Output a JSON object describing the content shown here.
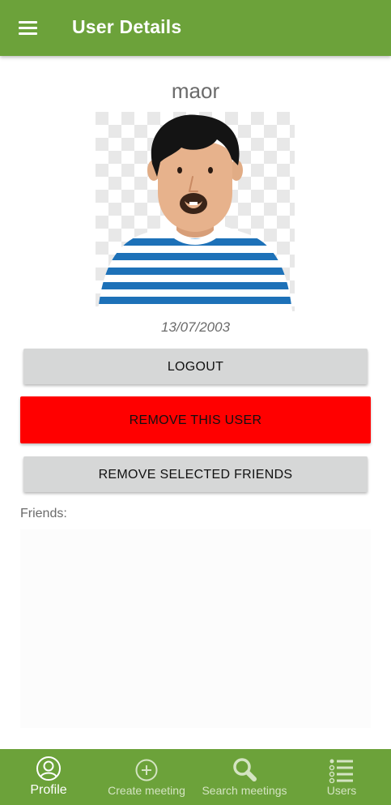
{
  "appbar": {
    "title": "User Details",
    "menu_icon": "hamburger-menu-icon",
    "color": "#6ca23a"
  },
  "profile": {
    "username": "maor",
    "birth_date": "13/07/2003",
    "avatar_icon": "user-avatar-illustration"
  },
  "actions": {
    "logout_label": "LOGOUT",
    "remove_user_label": "REMOVE THIS USER",
    "remove_friends_label": "REMOVE SELECTED FRIENDS",
    "remove_user_color": "#ff0000"
  },
  "friends": {
    "label": "Friends:",
    "items": []
  },
  "bottom_nav": {
    "items": [
      {
        "label": "Profile",
        "icon": "profile-icon",
        "active": true
      },
      {
        "label": "Create meeting",
        "icon": "add-circle-icon",
        "active": false
      },
      {
        "label": "Search meetings",
        "icon": "search-icon",
        "active": false
      },
      {
        "label": "Users",
        "icon": "users-list-icon",
        "active": false
      }
    ]
  }
}
